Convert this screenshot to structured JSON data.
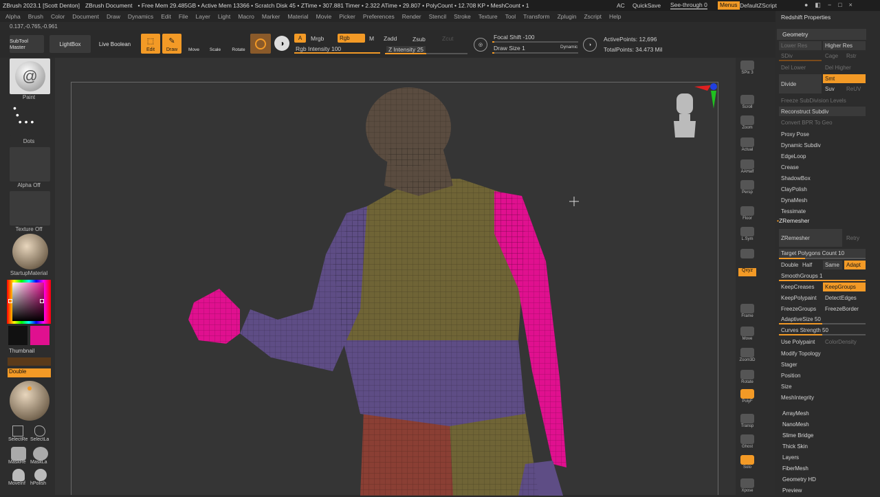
{
  "titlebar": {
    "app": "ZBrush 2023.1 [Scott Denton]",
    "doc": "ZBrush Document",
    "stats": "• Free Mem 29.485GB • Active Mem 13366 • Scratch Disk 45 • ZTime • 307.881 Timer • 2.322 ATime • 29.807 • PolyCount • 12.708 KP • MeshCount • 1",
    "ac": "AC",
    "quicksave": "QuickSave",
    "seethrough": "See-through  0",
    "menus": "Menus",
    "script": "DefaultZScript"
  },
  "menu": [
    "Alpha",
    "Brush",
    "Color",
    "Document",
    "Draw",
    "Dynamics",
    "Edit",
    "File",
    "Layer",
    "Light",
    "Macro",
    "Marker",
    "Material",
    "Movie",
    "Picker",
    "Preferences",
    "Render",
    "Stencil",
    "Stroke",
    "Texture",
    "Tool",
    "Transform",
    "Zplugin",
    "Zscript",
    "Help"
  ],
  "coords": "0.137,-0.765,-0.961",
  "toolbar": {
    "subtool_master": "SubTool Master",
    "lightbox": "LightBox",
    "live_boolean": "Live Boolean",
    "edit": "Edit",
    "draw": "Draw",
    "move": "Move",
    "scale": "Scale",
    "rotate": "Rotate",
    "a": "A",
    "mrgb": "Mrgb",
    "rgb": "Rgb",
    "m": "M",
    "zadd": "Zadd",
    "zsub": "Zsub",
    "zcut": "Zcut",
    "rgb_intensity": "Rgb Intensity 100",
    "z_intensity": "Z Intensity 25",
    "focal_shift": "Focal Shift -100",
    "draw_size": "Draw Size 1",
    "dynamic": "Dynamic",
    "active_points": "ActivePoints: 12,696",
    "total_points": "TotalPoints: 34.473 Mil"
  },
  "left": {
    "paint": "Paint",
    "dots": "Dots",
    "alpha_off": "Alpha Off",
    "texture_off": "Texture Off",
    "startup_material": "StartupMaterial",
    "thumbnail": "Thumbnail",
    "double": "Double",
    "selectrect": "SelectRe",
    "selectlasso": "SelectLa",
    "maskrect": "MaskRe",
    "masklasso": "MaskLa",
    "moveinf": "MoveInf",
    "hpolish": "hPolish"
  },
  "right_icons": [
    "SPix 3",
    "Scroll",
    "Zoom",
    "Actual",
    "AAHalf",
    "Persp",
    "Floor",
    "L.Sym",
    "",
    "Frame",
    "Move",
    "Zoom3D",
    "Rotate",
    "PolyF",
    "Transp",
    "Ghost",
    "Solo",
    "Xpose"
  ],
  "panel": {
    "header": "Redshift Properties",
    "geometry": "Geometry",
    "lower_res": "Lower Res",
    "higher_res": "Higher Res",
    "sdiv": "SDiv",
    "cage": "Cage",
    "rstr": "Rstr",
    "del_lower": "Del Lower",
    "del_higher": "Del Higher",
    "divide": "Divide",
    "smt": "Smt",
    "suv": "Suv",
    "reuv": "ReUV",
    "freeze_subdiv": "Freeze SubDivision Levels",
    "reconstruct": "Reconstruct Subdiv",
    "convert_bpr": "Convert BPR To Geo",
    "items": [
      "Proxy Pose",
      "Dynamic Subdiv",
      "EdgeLoop",
      "Crease",
      "ShadowBox",
      "ClayPolish",
      "DynaMesh",
      "Tessimate"
    ],
    "zremesher_header": "ZRemesher",
    "zremesher": "ZRemesher",
    "retry": "Retry",
    "target": "Target Polygons Count 10",
    "double": "Double",
    "half": "Half",
    "same": "Same",
    "adapt": "Adapt",
    "smoothgroups": "SmoothGroups 1",
    "keepcreases": "KeepCreases",
    "keepgroups": "KeepGroups",
    "keeppolypaint": "KeepPolypaint",
    "detectedges": "DetectEdges",
    "freezegroups": "FreezeGroups",
    "freezeborder": "FreezeBorder",
    "adaptivesize": "AdaptiveSize 50",
    "curves": "Curves Strength 50",
    "usepolypaint": "Use Polypaint",
    "colordensity": "ColorDensity",
    "more": [
      "Modify Topology",
      "Stager",
      "Position",
      "Size",
      "MeshIntegrity"
    ],
    "sub": [
      "ArrayMesh",
      "NanoMesh",
      "Slime Bridge",
      "Thick Skin",
      "Layers",
      "FiberMesh",
      "Geometry HD",
      "Preview"
    ]
  },
  "colors": {
    "accent": "#f39a26",
    "magenta": "#e0108f",
    "purple": "#5e4d85",
    "olive": "#6f6436",
    "red": "#8a3f34"
  }
}
